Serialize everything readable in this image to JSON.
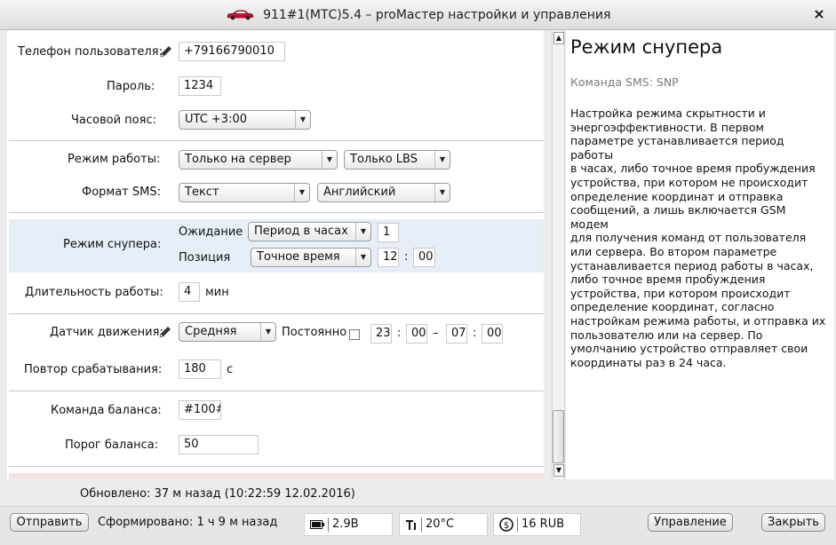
{
  "window": {
    "title": "911#1(МТС)5.4  –  proМастер настройки и управления",
    "close_glyph": "×"
  },
  "settings": {
    "phone": {
      "label": "Телефон пользователя:",
      "value": "+79166790010"
    },
    "password": {
      "label": "Пароль:",
      "value": "1234"
    },
    "timezone": {
      "label": "Часовой пояс:",
      "value": "UTC +3:00"
    },
    "mode": {
      "label": "Режим работы:",
      "value1": "Только на сервер",
      "value2": "Только LBS"
    },
    "sms_format": {
      "label": "Формат SMS:",
      "value1": "Текст",
      "value2": "Английский"
    },
    "sniper": {
      "label": "Режим снупера:",
      "wait_label": "Ожидание",
      "wait_mode": "Период в часах",
      "wait_value": "1",
      "position_label": "Позиция",
      "position_mode": "Точное время",
      "hour": "12",
      "minute": "00",
      "colon": ":"
    },
    "duration": {
      "label": "Длительность работы:",
      "value": "4",
      "unit": "мин"
    },
    "motion": {
      "label": "Датчик движения:",
      "value": "Средняя",
      "always_label": "Постоянно",
      "always_checked": false,
      "from_h": "23",
      "from_m": "00",
      "dash": "–",
      "to_h": "07",
      "to_m": "00",
      "colon": ":"
    },
    "repeat": {
      "label": "Повтор срабатывания:",
      "value": "180",
      "unit": "с"
    },
    "balance_cmd": {
      "label": "Команда баланса:",
      "value": "#100#"
    },
    "balance_threshold": {
      "label": "Порог баланса:",
      "value": "50"
    }
  },
  "help": {
    "title": "Режим снупера",
    "sms": "Команда SMS: SNP",
    "lines": [
      "Настройка режима скрытности и",
      "энергоэффективности. В первом",
      "параметре устанавливается период работы",
      "в часах, либо точное время пробуждения",
      "устройства, при котором не происходит",
      "определение координат и отправка",
      "сообщений, а лишь включается GSM модем",
      "для получения команд от пользователя",
      "или сервера. Во втором параметре",
      "устанавливается период работы в часах,",
      "либо точное время пробуждения",
      "устройства, при котором происходит",
      "определение координат, согласно",
      "настройкам режима работы, и отправка их",
      "пользователю или на сервер. По",
      "умолчанию устройство отправляет свои",
      "координаты раз в 24 часа."
    ]
  },
  "status": {
    "updated": "Обновлено:  37 м назад (10:22:59 12.02.2016)",
    "formed": "Сформировано:  1 ч 9 м назад",
    "battery": "2.9В",
    "temperature": "20°C",
    "balance": "16 RUB"
  },
  "buttons": {
    "send": "Отправить",
    "control": "Управление",
    "close": "Закрыть"
  },
  "colors": {
    "highlight_row": "#e6eef8",
    "bottom_row_hint": "#f7e3e3",
    "car_red": "#c8102e"
  }
}
